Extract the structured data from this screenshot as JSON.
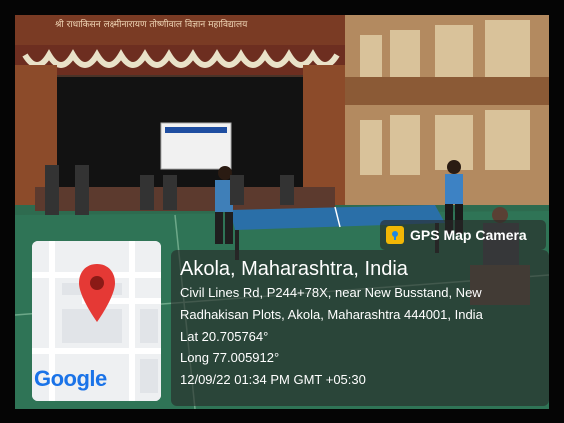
{
  "image": {
    "description_elements": [
      "auditorium-stage",
      "banner",
      "table-tennis-table",
      "players",
      "spectators"
    ]
  },
  "stage_banner": {
    "text": "श्री राधाकिसन लक्ष्मीनारायण तोष्णीवाल विज्ञान महाविद्यालय"
  },
  "gps_tag": {
    "label": "GPS Map Camera",
    "icon": "gps-map-camera-icon"
  },
  "location": {
    "title": "Akola, Maharashtra, India",
    "address_line1": "Civil Lines Rd, P244+78X, near New Busstand, New",
    "address_line2": "Radhakisan Plots, Akola, Maharashtra 444001, India",
    "lat": "Lat 20.705764°",
    "long": "Long 77.005912°",
    "datetime": "12/09/22 01:34 PM GMT +05:30"
  },
  "map": {
    "logo": "Google",
    "pin_icon": "map-pin-icon",
    "pin_color": "#e53935"
  }
}
